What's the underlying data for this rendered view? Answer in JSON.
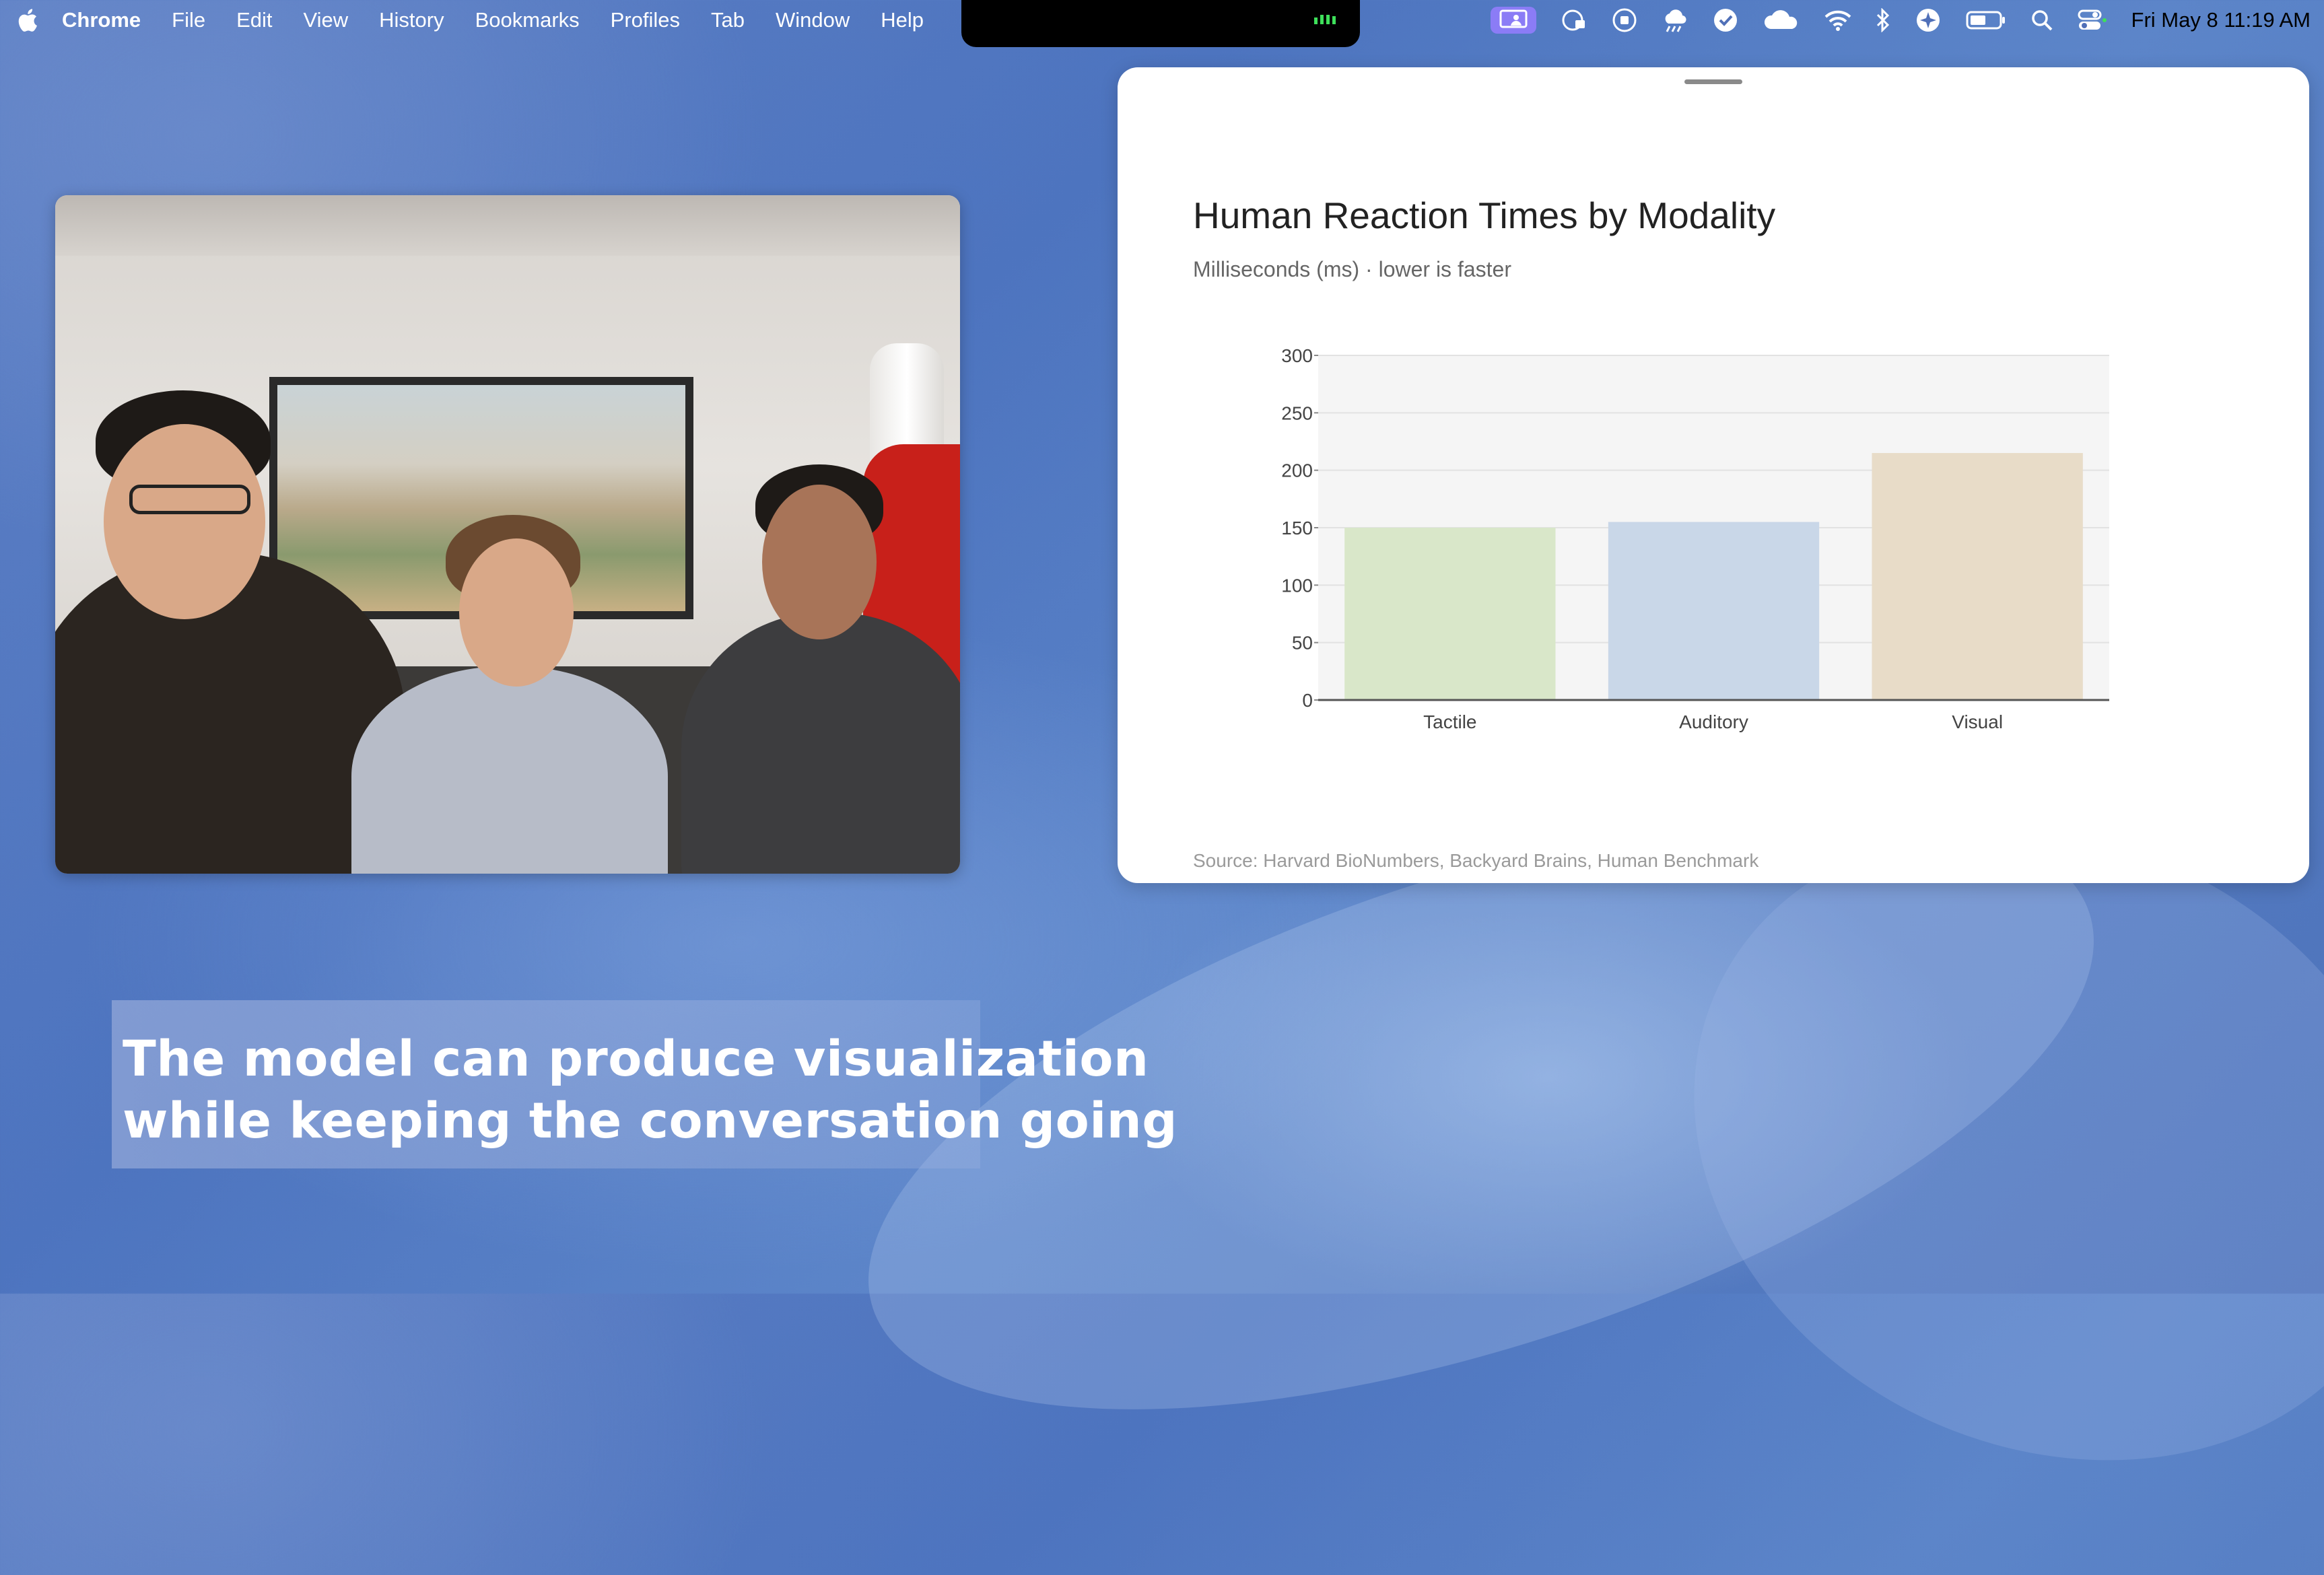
{
  "menubar": {
    "app_name": "Chrome",
    "items": [
      "File",
      "Edit",
      "View",
      "History",
      "Bookmarks",
      "Profiles",
      "Tab",
      "Window",
      "Help"
    ],
    "clock": "Fri May 8  11:19 AM"
  },
  "status_icons": [
    "screen-share-icon",
    "password-icon",
    "record-icon",
    "cloud-app-icon",
    "check-icon",
    "cloud-icon",
    "wifi-icon",
    "bluetooth-icon",
    "assistant-icon",
    "battery-icon",
    "search-icon",
    "control-center-icon"
  ],
  "chart_data": {
    "type": "bar",
    "title": "Human Reaction Times by Modality",
    "subtitle": "Milliseconds (ms) · lower is faster",
    "categories": [
      "Tactile",
      "Auditory",
      "Visual"
    ],
    "values": [
      150,
      155,
      215
    ],
    "colors": [
      "#d9e7c9",
      "#c9d7e8",
      "#e8dcc8"
    ],
    "ylim": [
      0,
      300
    ],
    "yticks": [
      0,
      50,
      100,
      150,
      200,
      250,
      300
    ],
    "xlabel": "",
    "ylabel": "",
    "grid": true,
    "source": "Source: Harvard BioNumbers, Backyard Brains, Human Benchmark"
  },
  "caption": {
    "line1": "The model can produce visualization",
    "line2": "while keeping the conversation going"
  }
}
